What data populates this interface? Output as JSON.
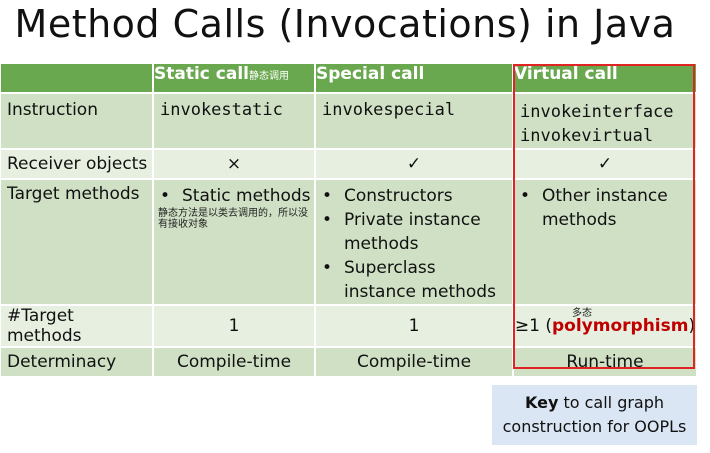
{
  "title": "Method Calls (Invocations) in Java",
  "columns": {
    "c1": "Static call",
    "c1_note": "静态调用",
    "c2": "Special call",
    "c3": "Virtual call"
  },
  "rows": {
    "instruction": {
      "label": "Instruction",
      "c1": "invokestatic",
      "c2": "invokespecial",
      "c3a": "invokeinterface",
      "c3b": "invokevirtual"
    },
    "receiver": {
      "label": "Receiver objects",
      "c1": "×",
      "c2": "✓",
      "c3": "✓"
    },
    "target": {
      "label": "Target methods",
      "c1_items": [
        "Static methods"
      ],
      "c1_note": "静态方法是以类去调用的，所以没有接收对象",
      "c2_items": [
        "Constructors",
        "Private instance methods",
        "Superclass instance methods"
      ],
      "c3_items": [
        "Other instance methods"
      ]
    },
    "count": {
      "label": "#Target methods",
      "c1": "1",
      "c2": "1",
      "c3_prefix": "≥1 (",
      "c3_em": "polymorphism",
      "c3_suffix": ")",
      "c3_note": "多态"
    },
    "determinacy": {
      "label": "Determinacy",
      "c1": "Compile-time",
      "c2": "Compile-time",
      "c3": "Run-time"
    }
  },
  "key": {
    "bold": "Key",
    "rest1": " to call graph",
    "line2": "construction for OOPLs"
  },
  "colors": {
    "header": "#6aa84f",
    "row_dark": "#cfe0c4",
    "row_light": "#e6efe0",
    "highlight_border": "#e02424",
    "emphasis": "#c00000",
    "key_bg": "#dae6f3"
  }
}
